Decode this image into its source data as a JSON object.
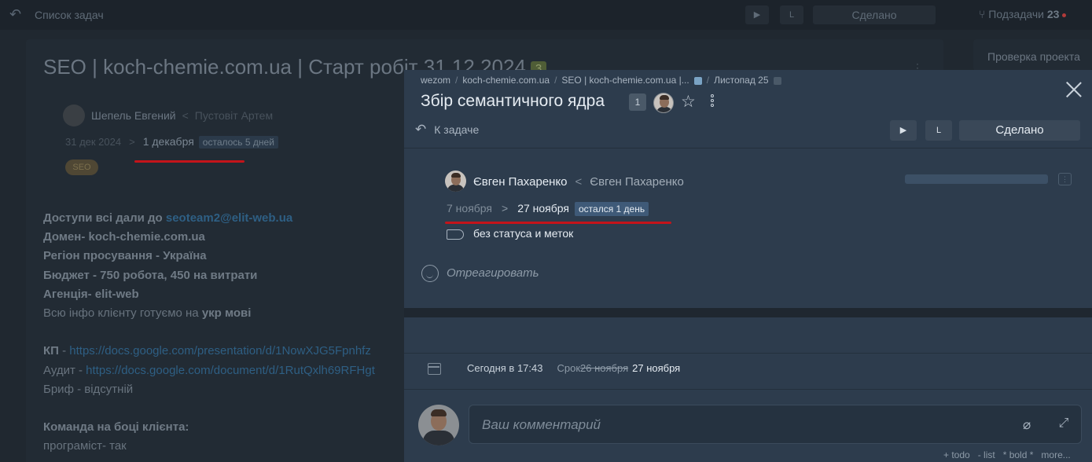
{
  "topbar": {
    "title": "Список задач",
    "play_label": "▶",
    "timer_label": "L",
    "done_label": "Сделано",
    "subtasks_label": "Подзадачи",
    "subtasks_count": "23"
  },
  "background_task": {
    "title": "SEO | koch-chemie.com.ua | Старт робіт 31.12.2024",
    "badge": "3",
    "owner": "Шепель Евгений",
    "collaborator": "Пустовіт Артем",
    "start_date": "31 дек 2024",
    "due_date": "1 декабря",
    "remaining": "осталось 5 дней",
    "tag": "SEO",
    "body_lines": [
      [
        {
          "t": "Доступи всі дали до ",
          "b": true
        },
        {
          "t": "seoteam2@elit-web.ua",
          "link": true,
          "b": true
        }
      ],
      [
        {
          "t": "Домен- koch-chemie.com.ua",
          "b": true
        }
      ],
      [
        {
          "t": "Регіон просування - Україна",
          "b": true
        }
      ],
      [
        {
          "t": "Бюджет - 750 робота, 450 на витрати",
          "b": true
        }
      ],
      [
        {
          "t": "Агенція- elit-web",
          "b": true
        }
      ],
      [
        {
          "t": "Всю інфо клієнту готуємо на "
        },
        {
          "t": "укр мові",
          "b": true
        }
      ],
      [
        {
          "t": ""
        }
      ],
      [
        {
          "t": "КП",
          "b": true
        },
        {
          "t": " - "
        },
        {
          "t": "https://docs.google.com/presentation/d/1NowXJG5Fpnhfz",
          "link": true
        }
      ],
      [
        {
          "t": "Аудит - "
        },
        {
          "t": "https://docs.google.com/document/d/1RutQxlh69RFHgt",
          "link": true
        }
      ],
      [
        {
          "t": "Бриф - відсутній"
        }
      ],
      [
        {
          "t": ""
        }
      ],
      [
        {
          "t": "Команда на боці клієнта:",
          "b": true
        }
      ],
      [
        {
          "t": "програміст- так"
        }
      ]
    ]
  },
  "right_card": {
    "title": "Проверка проекта"
  },
  "modal": {
    "breadcrumbs": [
      "wezom",
      "koch-chemie.com.ua",
      "SEO | koch-chemie.com.ua |...",
      "Листопад 25"
    ],
    "title": "Збір семантичного ядра",
    "count": "1",
    "back_label": "К задаче",
    "play_label": "▶",
    "timer_label": "L",
    "done_label": "Сделано",
    "assignee": "Євген Пахаренко",
    "collaborator": "Євген Пахаренко",
    "start_date": "7 ноября",
    "due_date": "27 ноября",
    "remaining": "остался 1 день",
    "status_text": "без статуса и меток",
    "react_label": "Отреагировать",
    "log": {
      "time": "Сегодня в 17:43",
      "label": "Срок",
      "old_date": "26 ноября",
      "new_date": "27 ноября"
    },
    "comment_placeholder": "Ваш комментарий",
    "format_hints": [
      "+ todo",
      "- list",
      "* bold *",
      "more..."
    ]
  },
  "colors": {
    "accent_underline": "#c4141a",
    "modal_bg": "#2d3c4d",
    "remaining_badge": "#3f5a78"
  }
}
